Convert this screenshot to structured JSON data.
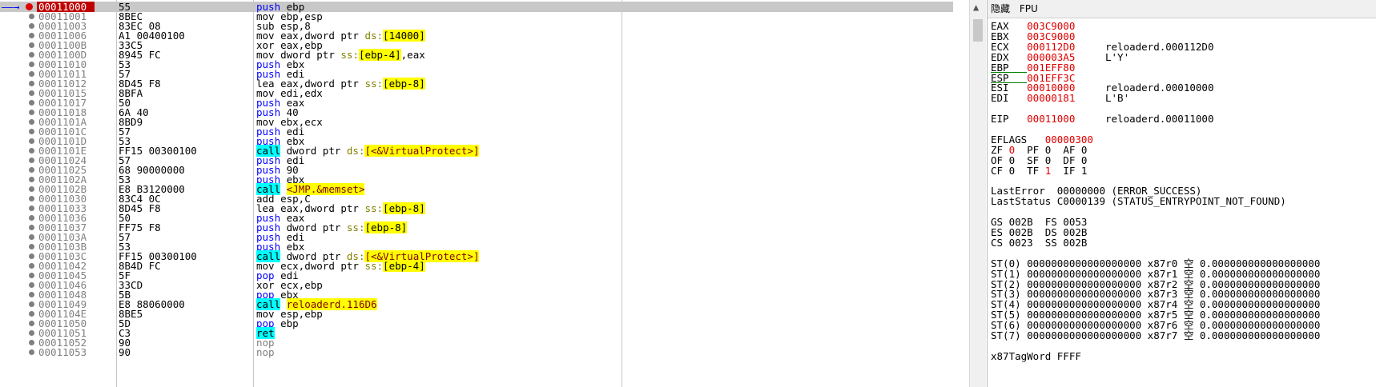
{
  "disasm": {
    "rows": [
      {
        "addr": "00011000",
        "bytes": "55",
        "mn": "push",
        "ops": "ebp"
      },
      {
        "addr": "00011001",
        "bytes": "8BEC",
        "mn": "mov",
        "ops": "ebp,esp"
      },
      {
        "addr": "00011003",
        "bytes": "83EC 08",
        "mn": "sub",
        "ops": "esp,8"
      },
      {
        "addr": "00011006",
        "bytes": "A1 00400100",
        "mn": "mov",
        "ops": "eax,dword ptr ds:[14000]"
      },
      {
        "addr": "0001100B",
        "bytes": "33C5",
        "mn": "xor",
        "ops": "eax,ebp"
      },
      {
        "addr": "0001100D",
        "bytes": "8945 FC",
        "mn": "mov",
        "ops": "dword ptr ss:[ebp-4],eax"
      },
      {
        "addr": "00011010",
        "bytes": "53",
        "mn": "push",
        "ops": "ebx"
      },
      {
        "addr": "00011011",
        "bytes": "57",
        "mn": "push",
        "ops": "edi"
      },
      {
        "addr": "00011012",
        "bytes": "8D45 F8",
        "mn": "lea",
        "ops": "eax,dword ptr ss:[ebp-8]"
      },
      {
        "addr": "00011015",
        "bytes": "8BFA",
        "mn": "mov",
        "ops": "edi,edx"
      },
      {
        "addr": "00011017",
        "bytes": "50",
        "mn": "push",
        "ops": "eax"
      },
      {
        "addr": "00011018",
        "bytes": "6A 40",
        "mn": "push",
        "ops": "40"
      },
      {
        "addr": "0001101A",
        "bytes": "8BD9",
        "mn": "mov",
        "ops": "ebx,ecx"
      },
      {
        "addr": "0001101C",
        "bytes": "57",
        "mn": "push",
        "ops": "edi"
      },
      {
        "addr": "0001101D",
        "bytes": "53",
        "mn": "push",
        "ops": "ebx"
      },
      {
        "addr": "0001101E",
        "bytes": "FF15 00300100",
        "mn": "call",
        "ops": "dword ptr ds:[<&VirtualProtect>]"
      },
      {
        "addr": "00011024",
        "bytes": "57",
        "mn": "push",
        "ops": "edi"
      },
      {
        "addr": "00011025",
        "bytes": "68 90000000",
        "mn": "push",
        "ops": "90"
      },
      {
        "addr": "0001102A",
        "bytes": "53",
        "mn": "push",
        "ops": "ebx"
      },
      {
        "addr": "0001102B",
        "bytes": "E8 B3120000",
        "mn": "call",
        "ops": "<JMP.&memset>"
      },
      {
        "addr": "00011030",
        "bytes": "83C4 0C",
        "mn": "add",
        "ops": "esp,C"
      },
      {
        "addr": "00011033",
        "bytes": "8D45 F8",
        "mn": "lea",
        "ops": "eax,dword ptr ss:[ebp-8]"
      },
      {
        "addr": "00011036",
        "bytes": "50",
        "mn": "push",
        "ops": "eax"
      },
      {
        "addr": "00011037",
        "bytes": "FF75 F8",
        "mn": "push",
        "ops": "dword ptr ss:[ebp-8]"
      },
      {
        "addr": "0001103A",
        "bytes": "57",
        "mn": "push",
        "ops": "edi"
      },
      {
        "addr": "0001103B",
        "bytes": "53",
        "mn": "push",
        "ops": "ebx"
      },
      {
        "addr": "0001103C",
        "bytes": "FF15 00300100",
        "mn": "call",
        "ops": "dword ptr ds:[<&VirtualProtect>]"
      },
      {
        "addr": "00011042",
        "bytes": "8B4D FC",
        "mn": "mov",
        "ops": "ecx,dword ptr ss:[ebp-4]"
      },
      {
        "addr": "00011045",
        "bytes": "5F",
        "mn": "pop",
        "ops": "edi"
      },
      {
        "addr": "00011046",
        "bytes": "33CD",
        "mn": "xor",
        "ops": "ecx,ebp"
      },
      {
        "addr": "00011048",
        "bytes": "5B",
        "mn": "pop",
        "ops": "ebx"
      },
      {
        "addr": "00011049",
        "bytes": "E8 88060000",
        "mn": "call",
        "ops": "reloaderd.116D6"
      },
      {
        "addr": "0001104E",
        "bytes": "8BE5",
        "mn": "mov",
        "ops": "esp,ebp"
      },
      {
        "addr": "00011050",
        "bytes": "5D",
        "mn": "pop",
        "ops": "ebp"
      },
      {
        "addr": "00011051",
        "bytes": "C3",
        "mn": "ret",
        "ops": ""
      },
      {
        "addr": "00011052",
        "bytes": "90",
        "mn": "nop",
        "ops": ""
      },
      {
        "addr": "00011053",
        "bytes": "90",
        "mn": "nop",
        "ops": ""
      }
    ]
  },
  "regs": {
    "tab_hide": "隐藏",
    "tab_fpu": "FPU",
    "lines": [
      "EAX   003C9000",
      "EBX   003C9000",
      "ECX   000112D0     reloaderd.000112D0",
      "EDX   000003A5     L'Y'",
      "EBP   001EFF80",
      "ESP   001EFF3C",
      "ESI   00010000     reloaderd.00010000",
      "EDI   00000181     L'B'",
      "",
      "EIP   00011000     reloaderd.00011000",
      "",
      "EFLAGS   00000300",
      "ZF 0  PF 0  AF 0",
      "OF 0  SF 0  DF 0",
      "CF 0  TF 1  IF 1",
      "",
      "LastError  00000000 (ERROR_SUCCESS)",
      "LastStatus C0000139 (STATUS_ENTRYPOINT_NOT_FOUND)",
      "",
      "GS 002B  FS 0053",
      "ES 002B  DS 002B",
      "CS 0023  SS 002B",
      "",
      "ST(0) 0000000000000000000 x87r0 空 0.000000000000000000",
      "ST(1) 0000000000000000000 x87r1 空 0.000000000000000000",
      "ST(2) 0000000000000000000 x87r2 空 0.000000000000000000",
      "ST(3) 0000000000000000000 x87r3 空 0.000000000000000000",
      "ST(4) 0000000000000000000 x87r4 空 0.000000000000000000",
      "ST(5) 0000000000000000000 x87r5 空 0.000000000000000000",
      "ST(6) 0000000000000000000 x87r6 空 0.000000000000000000",
      "ST(7) 0000000000000000000 x87r7 空 0.000000000000000000",
      "",
      "x87TagWord FFFF"
    ]
  }
}
